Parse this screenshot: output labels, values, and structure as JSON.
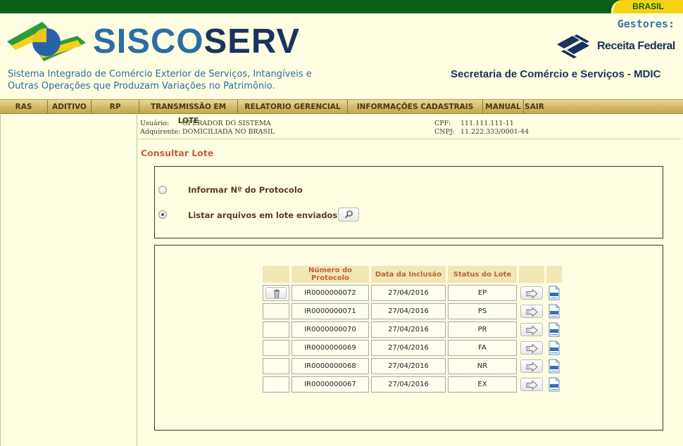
{
  "brand": {
    "gov_label": "BRASIL",
    "app_name_part1": "SISCO",
    "app_name_part2": "SERV",
    "subtitle_line1": "Sistema Integrado de Comércio Exterior de Serviços, Intangíveis e",
    "subtitle_line2": "Outras Operações que Produzam Variações no Patrimônio.",
    "gestores_label": "Gestores:",
    "receita_label": "Receita Federal",
    "secretaria_label": "Secretaria de Comércio e Serviços - MDIC"
  },
  "menu": {
    "items": [
      {
        "label": "RAS"
      },
      {
        "label": "ADITIVO"
      },
      {
        "label": "RP"
      },
      {
        "label": "TRANSMISSÃO EM LOTE"
      },
      {
        "label": "RELATORIO GERENCIAL"
      },
      {
        "label": "INFORMAÇÕES CADASTRAIS"
      },
      {
        "label": "MANUAL"
      },
      {
        "label": "SAIR"
      }
    ]
  },
  "user_info": {
    "usuario_label": "Usuário:",
    "usuario_value": "OPERADOR DO SISTEMA",
    "adquirente_label": "Adquirente:",
    "adquirente_value": "DOMICILIADA NO BRASIL",
    "cpf_label": "CPF:",
    "cpf_value": "111.111.111-11",
    "cnpj_label": "CNPJ:",
    "cnpj_value": "11.222.333/0001-44"
  },
  "page": {
    "title": "Consultar Lote",
    "options": {
      "protocolo_label": "Informar Nº do Protocolo",
      "listar_label": "Listar arquivos em lote enviados",
      "selected": "listar"
    }
  },
  "table": {
    "headers": [
      "",
      "Número do Protocolo",
      "Data da Inclusão",
      "Status do Lote",
      "",
      ""
    ],
    "rows": [
      {
        "protocolo": "IR0000000072",
        "data": "27/04/2016",
        "status": "EP",
        "deletable": true
      },
      {
        "protocolo": "IR0000000071",
        "data": "27/04/2016",
        "status": "PS",
        "deletable": false
      },
      {
        "protocolo": "IR0000000070",
        "data": "27/04/2016",
        "status": "PR",
        "deletable": false
      },
      {
        "protocolo": "IR0000000069",
        "data": "27/04/2016",
        "status": "FA",
        "deletable": false
      },
      {
        "protocolo": "IR0000000068",
        "data": "27/04/2016",
        "status": "NR",
        "deletable": false
      },
      {
        "protocolo": "IR0000000067",
        "data": "27/04/2016",
        "status": "EX",
        "deletable": false
      }
    ]
  },
  "icons": {
    "delete": "trash-icon",
    "view": "arrow-right-icon",
    "download": "xml-file-icon",
    "search": "magnifier-icon"
  }
}
